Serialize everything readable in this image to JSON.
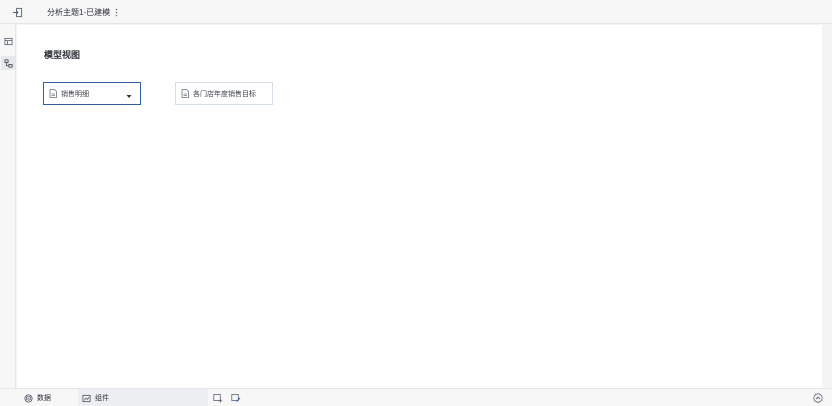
{
  "header": {
    "title": "分析主题1-已建模"
  },
  "leftbar": {
    "items": [
      {
        "icon": "table-list-icon"
      },
      {
        "icon": "model-relation-icon",
        "active": true
      }
    ]
  },
  "canvas": {
    "view_title": "模型视图",
    "tables": [
      {
        "label": "销售明细",
        "icon": "table-icon",
        "selected": true,
        "has_dropdown": true
      },
      {
        "label": "各门店年度销售目标",
        "icon": "table-icon",
        "selected": false
      }
    ]
  },
  "bottombar": {
    "tabs": [
      {
        "label": "数据",
        "icon": "database-icon"
      },
      {
        "label": "组件",
        "icon": "chart-icon"
      }
    ],
    "tools": [
      "add-component-icon",
      "edit-component-icon"
    ],
    "collapse_icon": "chevron-up-circle-icon"
  },
  "colors": {
    "selected_border": "#2f5f9e",
    "node_border": "#d6dee8",
    "canvas_bg": "#ffffff",
    "chrome_bg": "#f7f7f8"
  }
}
